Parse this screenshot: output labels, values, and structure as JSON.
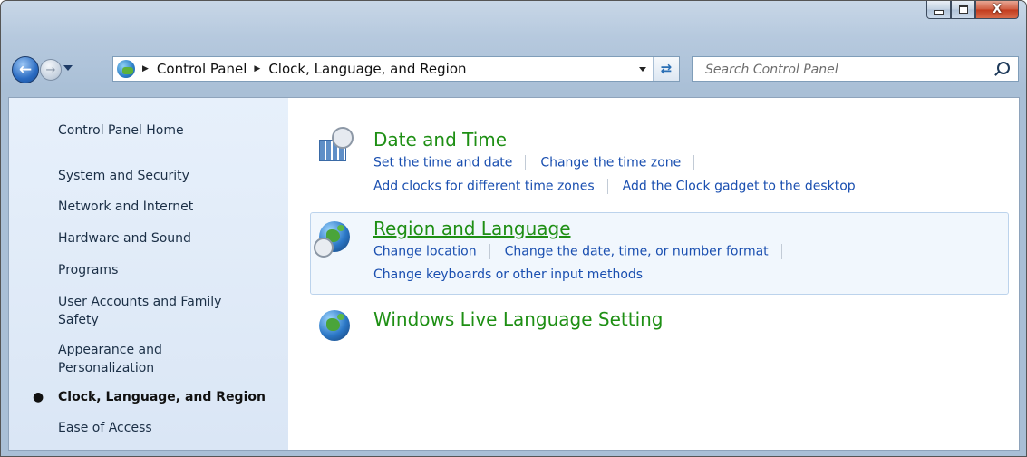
{
  "window": {
    "buttons": {
      "minimize": "minimize",
      "maximize": "maximize",
      "close": "X"
    }
  },
  "navbar": {
    "back_icon": "back-arrow-icon",
    "forward_icon": "forward-arrow-icon",
    "breadcrumbs": [
      "Control Panel",
      "Clock, Language, and Region"
    ],
    "search_placeholder": "Search Control Panel"
  },
  "sidebar": {
    "items": [
      {
        "label": "Control Panel Home"
      },
      {
        "label": "System and Security"
      },
      {
        "label": "Network and Internet"
      },
      {
        "label": "Hardware and Sound"
      },
      {
        "label": "Programs"
      },
      {
        "label": "User Accounts and Family Safety"
      },
      {
        "label": "Appearance and Personalization"
      },
      {
        "label": "Clock, Language, and Region",
        "current": true
      },
      {
        "label": "Ease of Access"
      }
    ]
  },
  "categories": [
    {
      "title": "Date and Time",
      "icon": "calendar-clock-icon",
      "links": [
        "Set the time and date",
        "Change the time zone",
        "Add clocks for different time zones",
        "Add the Clock gadget to the desktop"
      ]
    },
    {
      "title": "Region and Language",
      "icon": "globe-clock-icon",
      "links": [
        "Change location",
        "Change the date, time, or number format",
        "Change keyboards or other input methods"
      ]
    },
    {
      "title": "Windows Live Language Setting",
      "icon": "globe-icon",
      "links": []
    }
  ],
  "colors": {
    "category_title": "#1e8f14",
    "link": "#1a4fb0",
    "sidebar_bg": "#e1ebf8"
  }
}
